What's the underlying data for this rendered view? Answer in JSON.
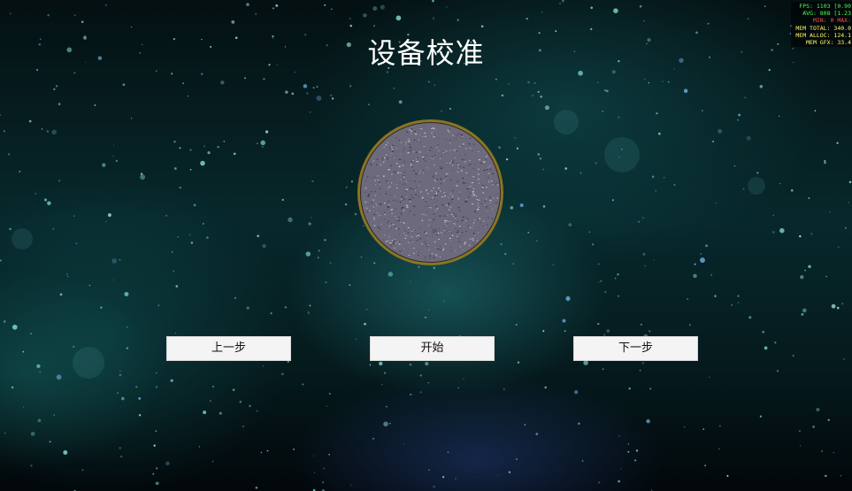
{
  "screen": {
    "title": "设备校准"
  },
  "buttons": {
    "prev_label": "上一步",
    "start_label": "开始",
    "next_label": "下一步"
  },
  "debug_stats": {
    "fps": "FPS: 1103 [0.90",
    "avg": "AVG: 808 [1.23",
    "min_max": "MIN: 0 MAX:",
    "mem_total": "MEM TOTAL: 340.0",
    "mem_alloc": "MEM ALLOC: 124.1",
    "mem_gfx": "MEM GFX: 33.4"
  },
  "icons": {
    "calibration_disc": "textured-disc-icon"
  },
  "colors": {
    "disc_fill": "#6e6a7e",
    "disc_border": "#8a7424",
    "button_bg": "#f4f4f4",
    "title_text": "#ffffff"
  }
}
